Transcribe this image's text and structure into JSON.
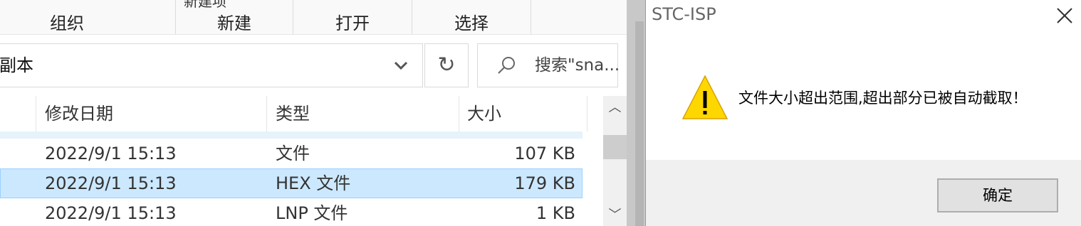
{
  "explorer": {
    "ribbon": {
      "partial_top_text": "新建项",
      "groups": [
        "组织",
        "新建",
        "打开",
        "选择"
      ]
    },
    "address": {
      "text": "副本"
    },
    "search": {
      "placeholder": "搜索\"sna..."
    },
    "columns": {
      "date": "修改日期",
      "type": "类型",
      "size": "大小"
    },
    "rows": [
      {
        "date": "2022/9/1 15:13",
        "type": "文件",
        "size": "107 KB",
        "selected": false
      },
      {
        "date": "2022/9/1 15:13",
        "type": "HEX 文件",
        "size": "179 KB",
        "selected": true
      },
      {
        "date": "2022/9/1 15:13",
        "type": "LNP 文件",
        "size": "1 KB",
        "selected": false
      }
    ]
  },
  "dialog": {
    "title": "STC-ISP",
    "message": "文件大小超出范围,超出部分已被自动截取！",
    "ok_label": "确定",
    "icons": {
      "warning": "warning-icon",
      "close": "close-icon"
    }
  },
  "colors": {
    "selection_bg": "#cce8ff",
    "selection_border": "#99d1ff",
    "warning_yellow": "#ffd700"
  }
}
